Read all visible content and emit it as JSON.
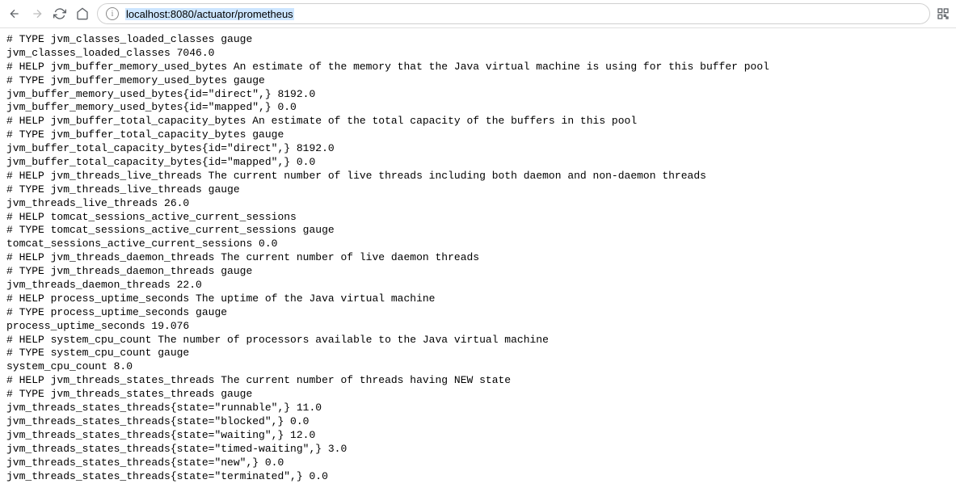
{
  "address": {
    "url": "localhost:8080/actuator/prometheus"
  },
  "metrics": {
    "text": "# TYPE jvm_classes_loaded_classes gauge\njvm_classes_loaded_classes 7046.0\n# HELP jvm_buffer_memory_used_bytes An estimate of the memory that the Java virtual machine is using for this buffer pool\n# TYPE jvm_buffer_memory_used_bytes gauge\njvm_buffer_memory_used_bytes{id=\"direct\",} 8192.0\njvm_buffer_memory_used_bytes{id=\"mapped\",} 0.0\n# HELP jvm_buffer_total_capacity_bytes An estimate of the total capacity of the buffers in this pool\n# TYPE jvm_buffer_total_capacity_bytes gauge\njvm_buffer_total_capacity_bytes{id=\"direct\",} 8192.0\njvm_buffer_total_capacity_bytes{id=\"mapped\",} 0.0\n# HELP jvm_threads_live_threads The current number of live threads including both daemon and non-daemon threads\n# TYPE jvm_threads_live_threads gauge\njvm_threads_live_threads 26.0\n# HELP tomcat_sessions_active_current_sessions  \n# TYPE tomcat_sessions_active_current_sessions gauge\ntomcat_sessions_active_current_sessions 0.0\n# HELP jvm_threads_daemon_threads The current number of live daemon threads\n# TYPE jvm_threads_daemon_threads gauge\njvm_threads_daemon_threads 22.0\n# HELP process_uptime_seconds The uptime of the Java virtual machine\n# TYPE process_uptime_seconds gauge\nprocess_uptime_seconds 19.076\n# HELP system_cpu_count The number of processors available to the Java virtual machine\n# TYPE system_cpu_count gauge\nsystem_cpu_count 8.0\n# HELP jvm_threads_states_threads The current number of threads having NEW state\n# TYPE jvm_threads_states_threads gauge\njvm_threads_states_threads{state=\"runnable\",} 11.0\njvm_threads_states_threads{state=\"blocked\",} 0.0\njvm_threads_states_threads{state=\"waiting\",} 12.0\njvm_threads_states_threads{state=\"timed-waiting\",} 3.0\njvm_threads_states_threads{state=\"new\",} 0.0\njvm_threads_states_threads{state=\"terminated\",} 0.0"
  }
}
